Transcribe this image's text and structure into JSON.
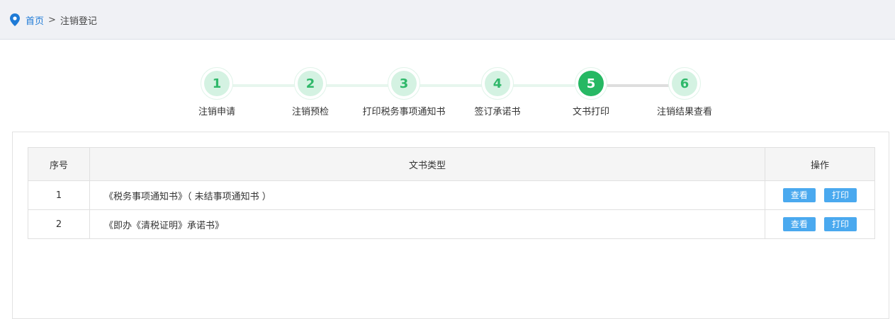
{
  "breadcrumb": {
    "home": "首页",
    "separator": ">",
    "current": "注销登记"
  },
  "steps": {
    "current_step": 5,
    "items": [
      {
        "number": "1",
        "label": "注销申请"
      },
      {
        "number": "2",
        "label": "注销预检"
      },
      {
        "number": "3",
        "label": "打印税务事项通知书"
      },
      {
        "number": "4",
        "label": "签订承诺书"
      },
      {
        "number": "5",
        "label": "文书打印"
      },
      {
        "number": "6",
        "label": "注销结果查看"
      }
    ]
  },
  "table": {
    "headers": {
      "index": "序号",
      "type": "文书类型",
      "ops": "操作"
    },
    "rows": [
      {
        "index": "1",
        "type": "《税务事项通知书》（ 未结事项通知书 ）",
        "view": "查看",
        "print": "打印"
      },
      {
        "index": "2",
        "type": "《即办《清税证明》承诺书》",
        "view": "查看",
        "print": "打印"
      }
    ]
  },
  "colors": {
    "accent_green": "#26b863",
    "step_light": "#d4f2e2",
    "button_blue": "#4aa9ef",
    "link_blue": "#1e7ad6"
  },
  "icons": {
    "breadcrumb": "location-pin-icon"
  }
}
